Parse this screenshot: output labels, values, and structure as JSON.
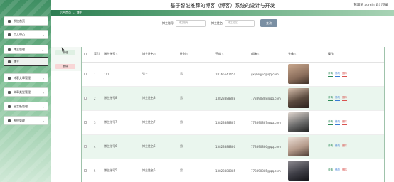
{
  "header": {
    "title": "基于智能推荐的博客（博客）系统的设计与开发",
    "user_info": "管理员 admin  退出登录"
  },
  "sidebar": {
    "items": [
      {
        "label": "系统首页",
        "icon": "home-icon"
      },
      {
        "label": "个人中心",
        "icon": "user-icon"
      },
      {
        "label": "博主管理",
        "icon": "grid-icon"
      },
      {
        "label": "博主",
        "icon": "user-icon"
      },
      {
        "label": "博客文章管理",
        "icon": "document-icon"
      },
      {
        "label": "文章类型管理",
        "icon": "tag-icon"
      },
      {
        "label": "留言板管理",
        "icon": "message-icon"
      },
      {
        "label": "系统管理",
        "icon": "gear-icon"
      }
    ]
  },
  "breadcrumb": {
    "home": "后台首页",
    "current": "博主"
  },
  "search": {
    "field1_label": "博主账号",
    "field1_placeholder": "博主账号",
    "field2_label": "博主姓名",
    "field2_placeholder": "博主姓名",
    "button": "查询"
  },
  "actions": {
    "add": "新增",
    "delete": "删除"
  },
  "table": {
    "headers": [
      "索引",
      "博主账号",
      "博主姓名",
      "性别",
      "手机",
      "邮箱",
      "头像",
      "操作"
    ],
    "ops": {
      "detail": "详情",
      "edit": "修改",
      "remove": "删除"
    },
    "rows": [
      {
        "index": "1",
        "account": "111",
        "name": "张三",
        "gender": "男",
        "phone": "18165641454",
        "email": "gxyhrqjkq@qq.com",
        "avatar": "#8a6d5b"
      },
      {
        "index": "2",
        "account": "博主账号8",
        "name": "博主姓名8",
        "gender": "男",
        "phone": "13823888888",
        "email": "773890888@qq.com",
        "avatar": "#5b4a3e"
      },
      {
        "index": "3",
        "account": "博主账号7",
        "name": "博主姓名7",
        "gender": "男",
        "phone": "13823888887",
        "email": "773890887@qq.com",
        "avatar": "#6b6b6b"
      },
      {
        "index": "4",
        "account": "博主账号6",
        "name": "博主姓名6",
        "gender": "男",
        "phone": "13823888886",
        "email": "773890886@qq.com",
        "avatar": "#b49a8a"
      },
      {
        "index": "5",
        "account": "博主账号5",
        "name": "博主姓名5",
        "gender": "男",
        "phone": "13823888885",
        "email": "773890885@qq.com",
        "avatar": "#3e3e46"
      }
    ]
  }
}
